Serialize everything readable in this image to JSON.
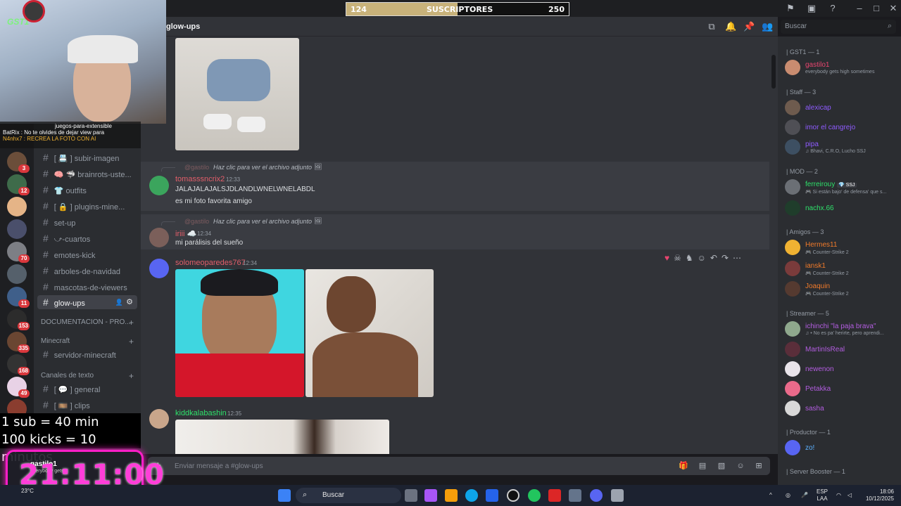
{
  "subscriber_bar": {
    "current": "124",
    "label": "SUSCRIPTORES",
    "goal": "250",
    "progress": 0.5
  },
  "header": {
    "channel": "glow-ups",
    "search_placeholder": "Buscar"
  },
  "channels": {
    "items": [
      {
        "label": "[ 📇 ] subir-imagen"
      },
      {
        "label": "🧠 🦈 brainrots-uste..."
      },
      {
        "label": "👕 outfits"
      },
      {
        "label": "[ 🔒 ] plugins-mine..."
      },
      {
        "label": "set-up"
      },
      {
        "label": "⤻-cuartos"
      },
      {
        "label": "emotes-kick"
      },
      {
        "label": "arboles-de-navidad"
      },
      {
        "label": "mascotas-de-viewers"
      },
      {
        "label": "glow-ups"
      }
    ],
    "cat_doc": "DOCUMENTACION - PRO...",
    "cat_minecraft": "Minecraft",
    "ch_minecraft": "servidor-minecraft",
    "cat_text": "Canales de texto",
    "ch_general": "[ 💬 ] general",
    "ch_clips": "[ 🎞️ ] clips"
  },
  "messages": {
    "m1": {
      "reply_user": "@gastilo",
      "reply_text": "Haz clic para ver el archivo adjunto",
      "user": "tomasssncrix2",
      "time": "12:33",
      "line1": "JALAJALAJALSJDLANDLWNELWNELABDL",
      "line2": "es mi foto favorita amigo"
    },
    "m2": {
      "reply_user": "@gastilo",
      "reply_text": "Haz clic para ver el archivo adjunto",
      "user": "iriii ☁️",
      "time": "12:34",
      "line1": "mi parálisis del sueño"
    },
    "m3": {
      "user": "solomeoparedes767",
      "time": "12:34"
    },
    "m4": {
      "user": "kiddkalabashin",
      "time": "12:35"
    }
  },
  "composer": {
    "placeholder": "Enviar mensaje a #glow-ups"
  },
  "members": {
    "groups": [
      {
        "title": "| GST1 — 1"
      },
      {
        "title": "| Staff — 3"
      },
      {
        "title": "| MOD — 2"
      },
      {
        "title": "| Amigos — 3"
      },
      {
        "title": "| Streamer — 5"
      },
      {
        "title": "| Productor — 1"
      },
      {
        "title": "| Server Booster — 1"
      }
    ],
    "list": [
      {
        "name": "gastilo1",
        "status": "everybody gets high sometimes",
        "color": "#e8456f"
      },
      {
        "name": "alexicap",
        "status": "",
        "color": "#8f5bff"
      },
      {
        "name": "imor el cangrejo",
        "status": "",
        "color": "#8f5bff"
      },
      {
        "name": "pipa",
        "status": "♫ Bhavi, C.R.O, Lucho SSJ",
        "color": "#8f5bff"
      },
      {
        "name": "ferreirouy",
        "status": "🎮 Si están bajo' de defensa' que s...",
        "color": "#2ee06a",
        "tag": "💎 SSJ"
      },
      {
        "name": "nachx.66",
        "status": "",
        "color": "#2ee06a"
      },
      {
        "name": "Hermes11",
        "status": "🎮 Counter-Strike 2",
        "color": "#f07a2a"
      },
      {
        "name": "iansk1",
        "status": "🎮 Counter-Strike 2",
        "color": "#f07a2a"
      },
      {
        "name": "Joaquin",
        "status": "🎮 Counter-Strike 2",
        "color": "#f07a2a"
      },
      {
        "name": "ichinchi \"la paja brava\"",
        "status": "♫ • No es pa' herirte, pero aprendi...",
        "color": "#b35de0"
      },
      {
        "name": "MartinIsReal",
        "status": "",
        "color": "#b35de0"
      },
      {
        "name": "newenon",
        "status": "",
        "color": "#b35de0"
      },
      {
        "name": "Petakka",
        "status": "",
        "color": "#b35de0"
      },
      {
        "name": "sasha",
        "status": "",
        "color": "#b35de0"
      },
      {
        "name": "zo!",
        "status": "",
        "color": "#5bb0ff"
      }
    ]
  },
  "overlay": {
    "cam_logo": "GST1",
    "chat_line1": "juegos-para-extensible",
    "chat_line2": "BatRix : No te olvides de dejar view para",
    "chat_line3": "N4nhx7 : RECREA LA FOTO CON AI",
    "sub_line1": "1 sub = 40 min",
    "sub_line2": "100 kicks = 10 minutos",
    "timer": "21:11:00",
    "timer_user": "gastilo1",
    "timer_status": "everybody gets"
  },
  "rail_badges": [
    "3",
    "12",
    "70",
    "11",
    "153",
    "335",
    "168",
    "49"
  ],
  "taskbar": {
    "search": "Buscar",
    "weather": "23°C",
    "lang1": "ESP",
    "lang2": "LAA",
    "time": "18:06",
    "date": "10/12/2025"
  },
  "colors": {
    "accent": "#5865f2",
    "blurple_dark": "#313338",
    "sidebar": "#2b2d31",
    "pink_timer": "#ff1ec8"
  }
}
